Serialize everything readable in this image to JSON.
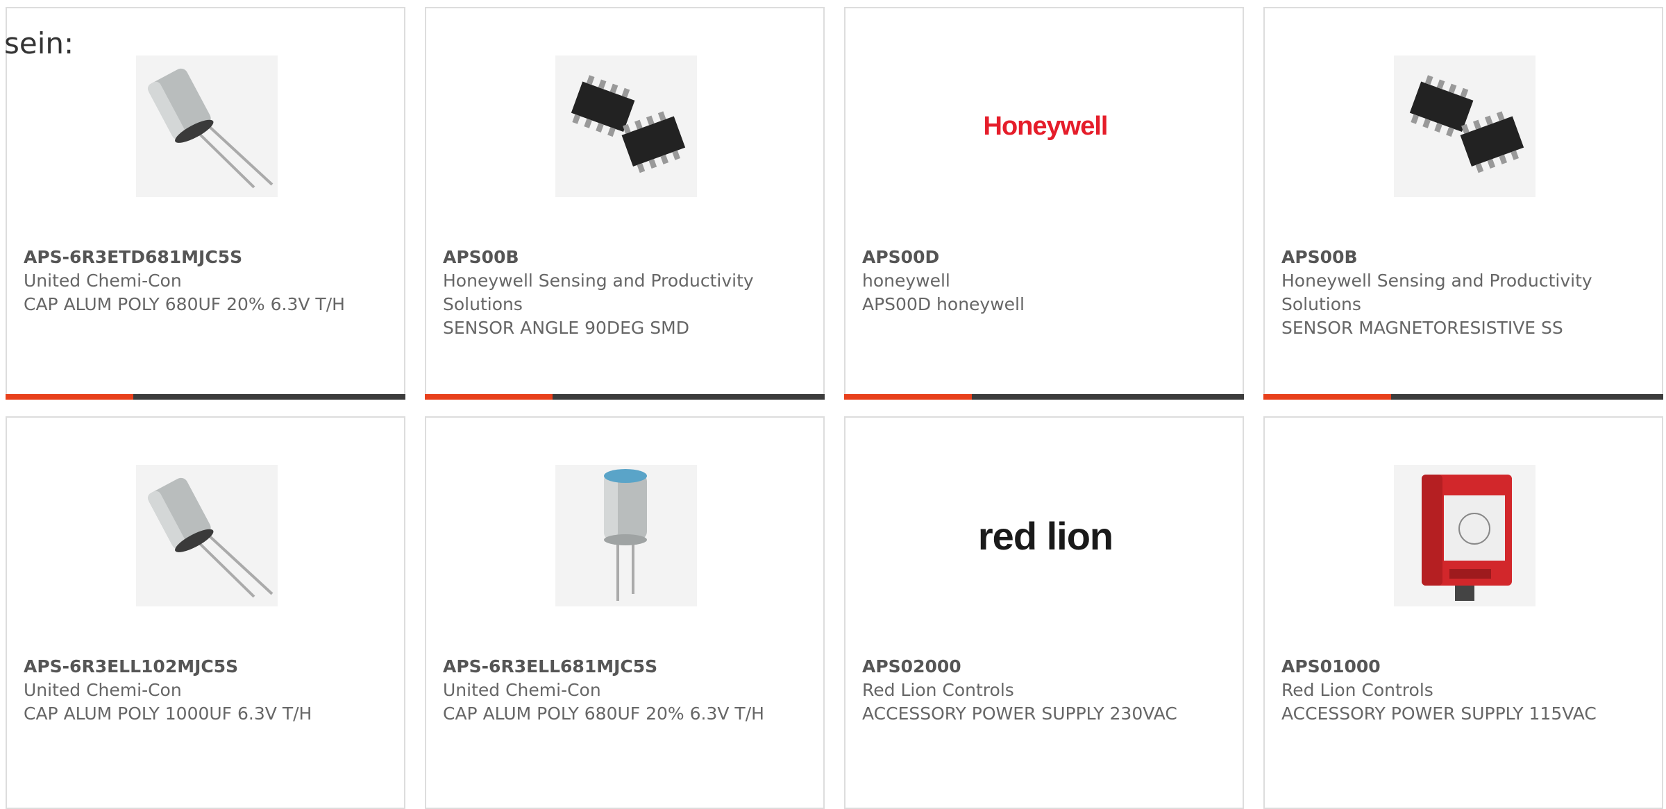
{
  "heading": "sein:",
  "products": [
    {
      "part_number": "APS-6R3ETD681MJC5S",
      "manufacturer": "United Chemi-Con",
      "description": "CAP ALUM POLY 680UF 20% 6.3V T/H",
      "image": "capacitor-radial"
    },
    {
      "part_number": "APS00B",
      "manufacturer": "Honeywell Sensing and Productivity Solutions",
      "description": "SENSOR ANGLE 90DEG SMD",
      "image": "soic-chip"
    },
    {
      "part_number": "APS00D",
      "manufacturer": "honeywell",
      "description": "APS00D honeywell",
      "image": "honeywell-logo",
      "logo_text": "Honeywell"
    },
    {
      "part_number": "APS00B",
      "manufacturer": "Honeywell Sensing and Productivity Solutions",
      "description": "SENSOR MAGNETORESISTIVE SS",
      "image": "soic-chip"
    },
    {
      "part_number": "APS-6R3ELL102MJC5S",
      "manufacturer": "United Chemi-Con",
      "description": "CAP ALUM POLY 1000UF 6.3V T/H",
      "image": "capacitor-radial"
    },
    {
      "part_number": "APS-6R3ELL681MJC5S",
      "manufacturer": "United Chemi-Con",
      "description": "CAP ALUM POLY 680UF 20% 6.3V T/H",
      "image": "capacitor-blue-top"
    },
    {
      "part_number": "APS02000",
      "manufacturer": "Red Lion Controls",
      "description": "ACCESSORY POWER SUPPLY 230VAC",
      "image": "red-lion-logo",
      "logo_text": "red lion"
    },
    {
      "part_number": "APS01000",
      "manufacturer": "Red Lion Controls",
      "description": "ACCESSORY POWER SUPPLY 115VAC",
      "image": "red-relay-module"
    }
  ],
  "colors": {
    "accent": "#e8401c",
    "bar": "#3c3c3c",
    "border": "#dddddd",
    "text": "#666666"
  }
}
